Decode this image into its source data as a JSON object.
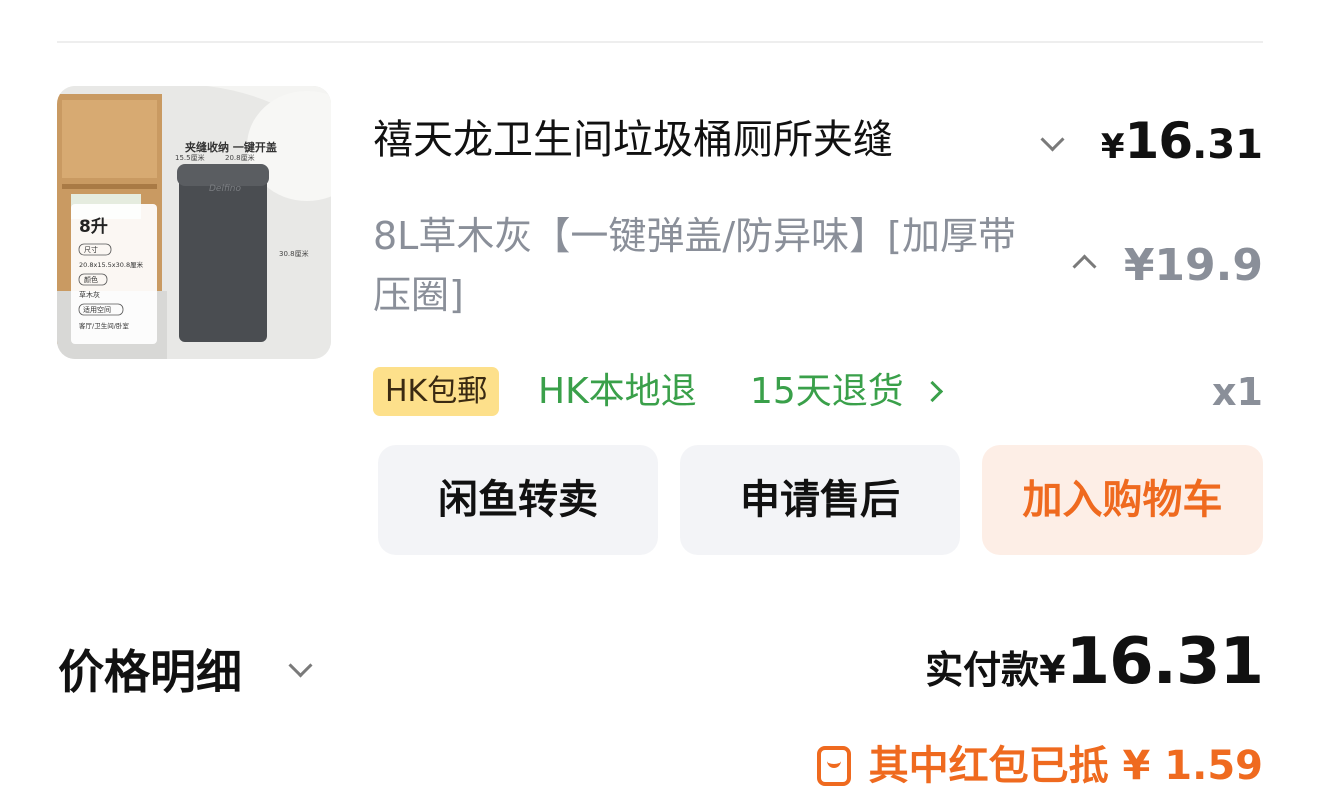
{
  "product": {
    "title": "禧天龙卫生间垃圾桶厕所夹缝",
    "price_yen": "¥",
    "price_int": "16",
    "price_dec": ".31",
    "spec": "8L草木灰【一键弹盖/防异味】[加厚带压圈]",
    "original_price": "¥19.9",
    "quantity": "x1",
    "image": {
      "volume_label": "8升",
      "size_label": "尺寸",
      "size_value": "20.8x15.5x30.8厘米",
      "color_label": "颜色",
      "color_value": "草木灰",
      "space_label": "适用空间",
      "space_value": "客厅/卫生间/卧室",
      "banner": "夹缝收纳 一键开盖",
      "dim_width": "15.5厘米",
      "dim_depth": "20.8厘米",
      "dim_height": "30.8厘米",
      "brand": "Delfino"
    }
  },
  "tags": {
    "shipping": "HK包郵",
    "local_return": "HK本地退",
    "return_days": "15天退货"
  },
  "actions": {
    "resell": "闲鱼转卖",
    "after_sale": "申请售后",
    "add_to_cart": "加入购物车"
  },
  "price_detail": {
    "label": "价格明细",
    "paid_label": "实付款¥",
    "paid_amount": "16.31",
    "red_packet": "其中红包已抵 ¥ 1.59"
  },
  "colors": {
    "accent_orange": "#ef6a1f",
    "green": "#3aa04a",
    "tag_yellow": "#fde08b",
    "gray_text": "#8a8f99"
  }
}
